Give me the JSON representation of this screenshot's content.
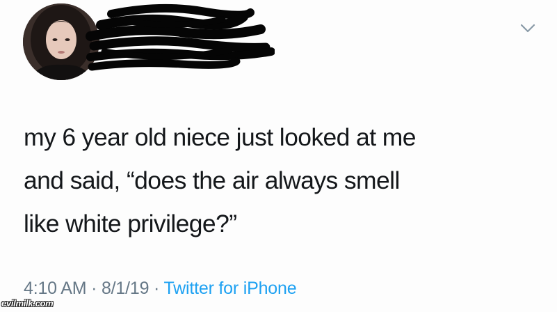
{
  "tweet": {
    "text": "my 6 year old niece just looked at me\nand said, “does the air always smell\nlike white privilege?”",
    "time": "4:10 AM",
    "separator": "·",
    "date": "8/1/19",
    "source": "Twitter for iPhone"
  },
  "icons": {
    "menu": "chevron-down-icon",
    "avatar": "avatar",
    "redaction": "redaction-scribble"
  },
  "watermark": "evilmilk.com",
  "colors": {
    "text": "#14171a",
    "meta": "#657786",
    "link": "#1da1f2"
  }
}
